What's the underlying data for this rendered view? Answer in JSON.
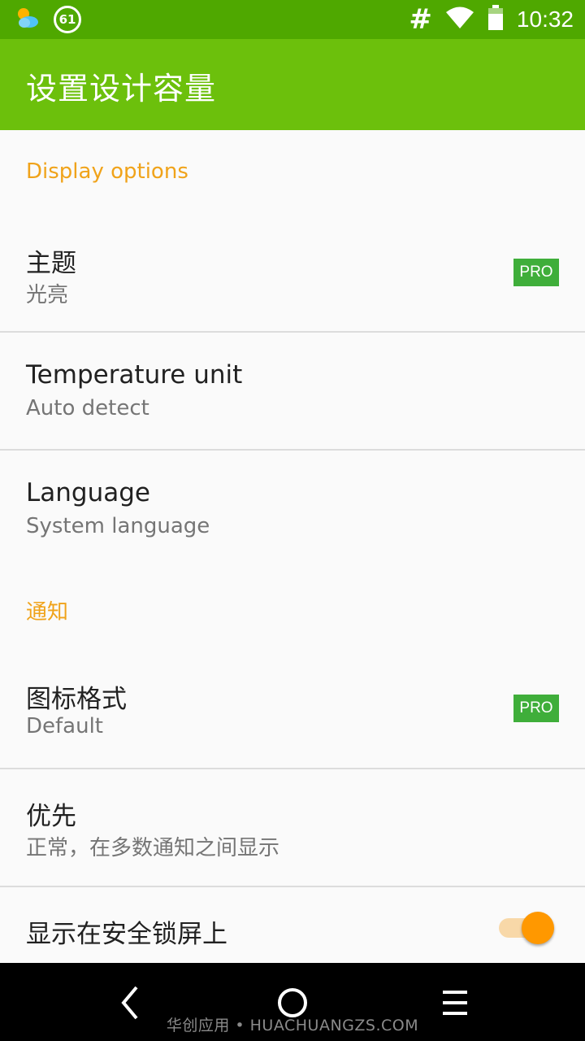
{
  "status_bar": {
    "weather_badge": "61",
    "signal_glyph": "#",
    "time": "10:32"
  },
  "app_bar": {
    "title": "设置设计容量"
  },
  "sections": {
    "display": {
      "header": "Display options"
    },
    "notify": {
      "header": "通知"
    }
  },
  "prefs": {
    "theme": {
      "title": "主题",
      "summary": "光亮",
      "badge": "PRO"
    },
    "temp": {
      "title": "Temperature unit",
      "summary": "Auto detect"
    },
    "lang": {
      "title": "Language",
      "summary": "System language"
    },
    "icon": {
      "title": "图标格式",
      "summary": "Default",
      "badge": "PRO"
    },
    "priority": {
      "title": "优先",
      "summary": "正常，在多数通知之间显示"
    },
    "lockscreen": {
      "title": "显示在安全锁屏上",
      "toggle_on": true
    }
  },
  "nav_bar": {
    "watermark": "华创应用 • HUACHUANGZS.COM"
  },
  "colors": {
    "status_bar": "#4fa800",
    "app_bar": "#6cc00c",
    "section_header": "#f0a31a",
    "pro_badge": "#3fae3a",
    "toggle_thumb": "#ff9800",
    "toggle_track": "#f8d8a8"
  }
}
